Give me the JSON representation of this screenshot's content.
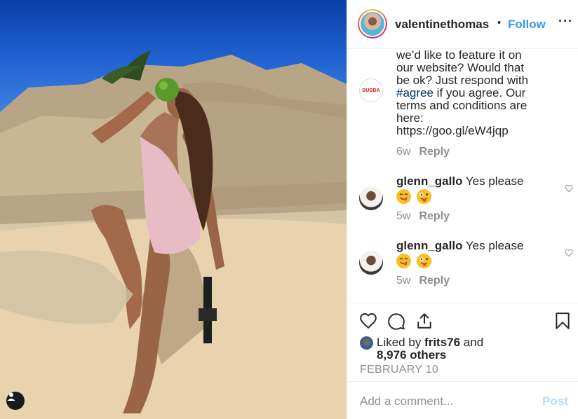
{
  "header": {
    "username": "valentinethomas",
    "separator": "•",
    "follow_label": "Follow",
    "more_label": "···"
  },
  "comments": [
    {
      "lines": [
        "we’d like to feature it on",
        "our website? Would that",
        "be ok? Just respond with"
      ],
      "hashtag": "#agree",
      "lines_after": [
        " if you agree. Our",
        "terms and conditions are",
        "here:",
        "https://goo.gl/eW4jqp"
      ],
      "avatar_text": "BUBBA",
      "time": "6w",
      "reply_label": "Reply"
    },
    {
      "username": "glenn_gallo",
      "text": "Yes please",
      "time": "5w",
      "reply_label": "Reply"
    },
    {
      "username": "glenn_gallo",
      "text": "Yes please",
      "time": "5w",
      "reply_label": "Reply"
    }
  ],
  "likes": {
    "prefix": "Liked by ",
    "user": "frits76",
    "middle": " and",
    "others": "8,976 others"
  },
  "post_date": "FEBRUARY 10",
  "comment_bar": {
    "placeholder": "Add a comment...",
    "post_label": "Post"
  },
  "colors": {
    "accent": "#3897f0",
    "post_disabled": "#b3dbff",
    "hashtag": "#003569"
  }
}
